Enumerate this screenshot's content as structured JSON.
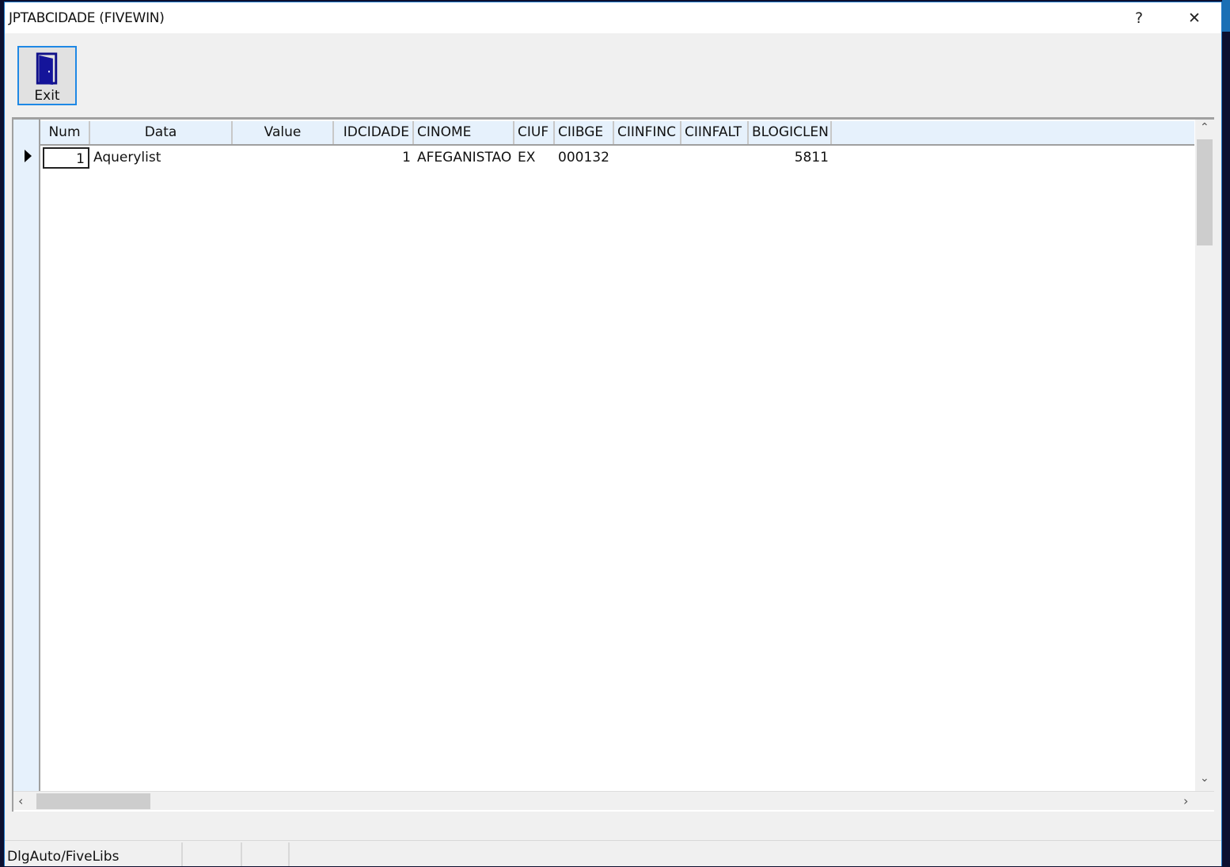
{
  "window": {
    "title": "JPTABCIDADE (FIVEWIN)",
    "help_label": "?",
    "close_label": "✕"
  },
  "toolbar": {
    "exit_label": "Exit"
  },
  "grid": {
    "columns": [
      "Num",
      "Data",
      "Value",
      "IDCIDADE",
      "CINOME",
      "CIUF",
      "CIIBGE",
      "CIINFINC",
      "CIINFALT",
      "BLOGICLEN"
    ],
    "rows": [
      {
        "num": "1",
        "data": "Aquerylist",
        "value": "",
        "idcidade": "1",
        "cinome": "AFEGANISTAO",
        "ciuf": "EX",
        "ciibge": "000132",
        "ciinfinc": "",
        "ciinfalt": "",
        "blogiclen": "5811"
      }
    ]
  },
  "statusbar": {
    "text": "DlgAuto/FiveLibs"
  },
  "colors": {
    "accent": "#1e88e5",
    "header_bg": "#e6f1fc"
  }
}
